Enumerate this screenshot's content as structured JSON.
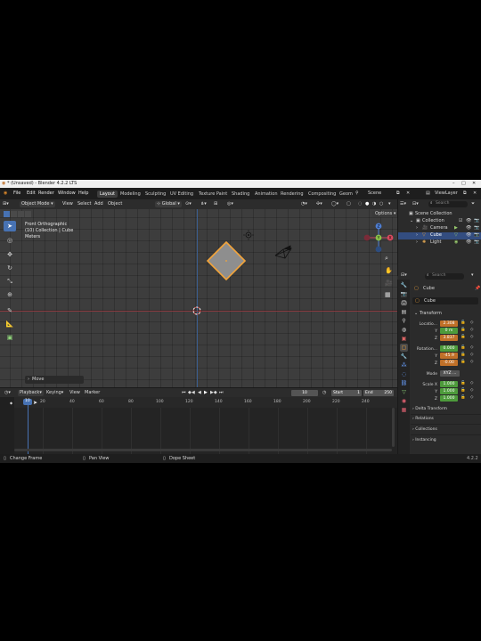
{
  "titlebar": {
    "text": "* (Unsaved) - Blender 4.2.2 LTS"
  },
  "menubar": {
    "menus": [
      "File",
      "Edit",
      "Render",
      "Window",
      "Help"
    ],
    "workspaces": [
      "Layout",
      "Modeling",
      "Sculpting",
      "UV Editing",
      "Texture Paint",
      "Shading",
      "Animation",
      "Rendering",
      "Compositing",
      "Geom"
    ],
    "scene": "Scene",
    "view_layer": "ViewLayer"
  },
  "viewport_header": {
    "mode": "Object Mode",
    "menus": [
      "View",
      "Select",
      "Add",
      "Object"
    ],
    "transform": "Global",
    "options": "Options"
  },
  "viewport": {
    "view_name": "Front Orthographic",
    "collection_info": "(10) Collection | Cube",
    "units": "Meters",
    "operator_panel": "Move",
    "gizmo": {
      "z": "Z",
      "y": "Y",
      "x": "X"
    }
  },
  "outliner": {
    "search_placeholder": "Search",
    "scene_collection": "Scene Collection",
    "collection": "Collection",
    "items": [
      "Camera",
      "Cube",
      "Light"
    ]
  },
  "properties": {
    "search_placeholder": "Search",
    "object_name": "Cube",
    "object_data": "Cube",
    "transform_title": "Transform",
    "location_label": "Locatio...",
    "location": [
      "2.308",
      "0 m",
      "3.837"
    ],
    "rotation_label": "Rotation...",
    "rotation": [
      "0.000",
      "-45.9",
      "-0.00"
    ],
    "mode_label": "Mode",
    "mode_value": "XYZ ...",
    "scale_label": "Scale X",
    "scale": [
      "1.000",
      "1.000",
      "1.000"
    ],
    "axis_labels": [
      "Y",
      "Z"
    ],
    "sections": [
      "Delta Transform",
      "Relations",
      "Collections",
      "Instancing"
    ]
  },
  "timeline_header": {
    "menus": [
      "Playback",
      "Keying",
      "View",
      "Marker"
    ],
    "current_frame": "10",
    "start_label": "Start",
    "start": "1",
    "end_label": "End",
    "end": "250"
  },
  "timeline": {
    "current_frame_badge": "10",
    "ticks": [
      "20",
      "40",
      "60",
      "80",
      "100",
      "120",
      "140",
      "160",
      "180",
      "200",
      "220",
      "240"
    ]
  },
  "statusbar": {
    "items": [
      "Change Frame",
      "Pan View",
      "Dope Sheet"
    ],
    "version": "4.2.2"
  },
  "colors": {
    "selection_active": "#4772b3",
    "location_field": "#c07028",
    "keyframed_field": "#4d9a3b",
    "cube_outline": "#f3a43a"
  }
}
